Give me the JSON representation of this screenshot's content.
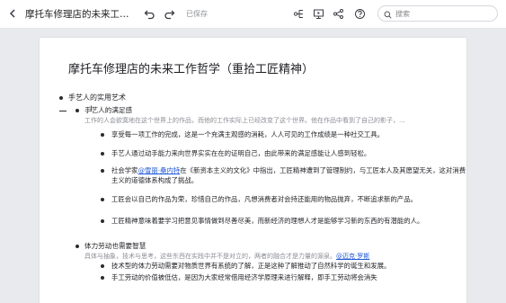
{
  "toolbar": {
    "doc_title": "摩托车修理店的未来工作哲...",
    "save_status": "已保存",
    "icons": [
      "back-icon",
      "undo-icon",
      "redo-icon",
      "mindmap-icon",
      "present-icon",
      "share-icon",
      "help-icon",
      "search-icon"
    ]
  },
  "search": {
    "placeholder": "搜索"
  },
  "document": {
    "title": "摩托车修理店的未来工作哲学（重拾工匠精神）",
    "sections": [
      {
        "label": "手艺人的实用艺术",
        "children": [
          {
            "label": "手艺人的满足感",
            "note": "工作的人会欲寞地在这个世界上的作品，而他的工作实际上已经改变了这个世界。他在作品中看到了自己的影子，...",
            "items": [
              {
                "text": "享受每一项工作的完成，这是一个充满主观感的消耗，人人可见的工作成绩是一种社交工具。"
              },
              {
                "text": "手艺人通过动手能力来向世界实实在在的证明自己，由此带来的满足感能让人感到轻松。"
              },
              {
                "pre": "社会学家",
                "link": "@雪丽·桑内特",
                "post": "在《新资本主义的文化》中指出，工匠精神遭到了管理制约，与工匠本人及其愿望无关，这对消费主义的道德体系构成了挑战。"
              },
              {
                "text": "工匠会以自己的作品为荣，珍惜自己的作品，凡想消费者对会持还能用的物品抛弃，不断追求新的产品。"
              },
              {
                "text": "工匠精神意味着要学习把意见事情做到尽善尽美，而新经济的理想人才是能够学习新的东西的有潜能的人。"
              }
            ]
          },
          {
            "label": "体力劳动也需要智慧",
            "note_pre": "具体与抽象，技术与思考，这些东西在实践中并不是对立的，两者的融合才是力量的源泉。",
            "note_link": "@迈克·罗斯",
            "items": [
              {
                "text": "技术型的体力劳动需要对物质世界有系统的了解，正是这种了解推动了自然科学的诞生和发展。"
              },
              {
                "text": "手工劳动的价值被低估，是因为大家经常借用经济学原理来进行解释，即手工劳动将会消失"
              }
            ]
          }
        ]
      }
    ]
  }
}
